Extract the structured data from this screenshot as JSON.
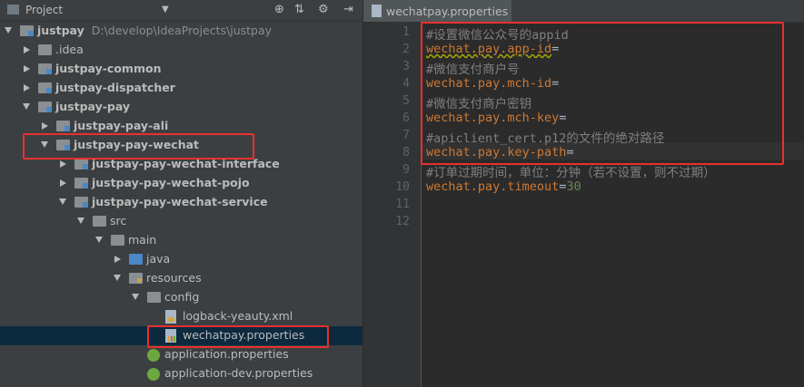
{
  "project_panel": {
    "title": "Project",
    "toolbar_icons": [
      "globe-icon",
      "collapse-icon",
      "settings-icon",
      "hide-icon"
    ]
  },
  "tree": [
    {
      "label": "justpay",
      "path": "D:\\develop\\IdeaProjects\\justpay",
      "bold": true,
      "expanded": true,
      "icon": "module-folder-icon"
    },
    {
      "label": ".idea",
      "bold": false,
      "expanded": false,
      "icon": "folder-icon"
    },
    {
      "label": "justpay-common",
      "bold": true,
      "expanded": false,
      "icon": "module-folder-icon"
    },
    {
      "label": "justpay-dispatcher",
      "bold": true,
      "expanded": false,
      "icon": "module-folder-icon"
    },
    {
      "label": "justpay-pay",
      "bold": true,
      "expanded": true,
      "icon": "module-folder-icon"
    },
    {
      "label": "justpay-pay-ali",
      "bold": true,
      "expanded": false,
      "icon": "module-folder-icon"
    },
    {
      "label": "justpay-pay-wechat",
      "bold": true,
      "expanded": true,
      "icon": "module-folder-icon"
    },
    {
      "label": "justpay-pay-wechat-interface",
      "bold": true,
      "expanded": false,
      "icon": "module-folder-icon"
    },
    {
      "label": "justpay-pay-wechat-pojo",
      "bold": true,
      "expanded": false,
      "icon": "module-folder-icon"
    },
    {
      "label": "justpay-pay-wechat-service",
      "bold": true,
      "expanded": true,
      "icon": "module-folder-icon"
    },
    {
      "label": "src",
      "bold": false,
      "expanded": true,
      "icon": "folder-icon"
    },
    {
      "label": "main",
      "bold": false,
      "expanded": true,
      "icon": "folder-icon"
    },
    {
      "label": "java",
      "bold": false,
      "expanded": false,
      "icon": "source-folder-icon"
    },
    {
      "label": "resources",
      "bold": false,
      "expanded": true,
      "icon": "resources-folder-icon"
    },
    {
      "label": "config",
      "bold": false,
      "expanded": true,
      "icon": "folder-icon"
    },
    {
      "label": "logback-yeauty.xml",
      "bold": false,
      "icon": "xml-file-icon"
    },
    {
      "label": "wechatpay.properties",
      "bold": false,
      "icon": "properties-file-icon",
      "selected": true
    },
    {
      "label": "application.properties",
      "bold": false,
      "icon": "spring-properties-icon"
    },
    {
      "label": "application-dev.properties",
      "bold": false,
      "icon": "spring-properties-icon"
    }
  ],
  "editor": {
    "tab_label": "wechatpay.properties",
    "lines": [
      {
        "n": "1",
        "text": "#设置微信公众号的appid",
        "kind": "comment"
      },
      {
        "n": "2",
        "key": "wechat.pay.app-id",
        "eq": "=",
        "value": "",
        "kind": "kv",
        "wavy": true
      },
      {
        "n": "3",
        "text": "#微信支付商户号",
        "kind": "comment"
      },
      {
        "n": "4",
        "key": "wechat.pay.mch-id",
        "eq": "=",
        "value": "",
        "kind": "kv"
      },
      {
        "n": "5",
        "text": "#微信支付商户密钥",
        "kind": "comment"
      },
      {
        "n": "6",
        "key": "wechat.pay.mch-key",
        "eq": "=",
        "value": "",
        "kind": "kv"
      },
      {
        "n": "7",
        "text": "#apiclient_cert.p12的文件的绝对路径",
        "kind": "comment"
      },
      {
        "n": "8",
        "key": "wechat.pay.key-path",
        "eq": "=",
        "value": "",
        "kind": "kv"
      },
      {
        "n": "9",
        "text": "#订单过期时间，单位：分钟（若不设置，则不过期）",
        "kind": "comment"
      },
      {
        "n": "10",
        "key": "wechat.pay.timeout",
        "eq": "=",
        "value": "30",
        "kind": "kv"
      },
      {
        "n": "11",
        "text": "",
        "kind": "blank"
      },
      {
        "n": "12",
        "text": "",
        "kind": "blank"
      }
    ]
  },
  "colors": {
    "highlight_box": "#e8302e",
    "key": "#cc7832",
    "comment": "#808080",
    "value": "#6a8759"
  }
}
